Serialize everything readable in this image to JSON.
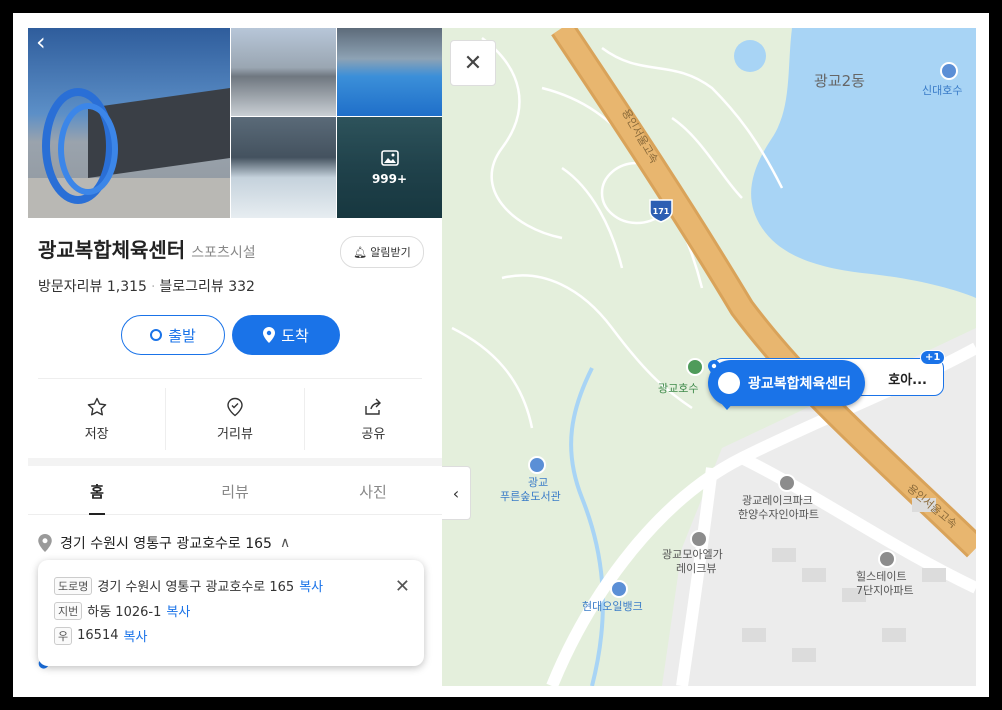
{
  "place": {
    "back_icon": "chevron-left-icon",
    "photo_count": "999+",
    "name": "광교복합체육센터",
    "category": "스포츠시설",
    "alarm_label": "알림받기",
    "visitor_reviews": "방문자리뷰 1,315",
    "blog_reviews": "블로그리뷰 332",
    "depart_label": "출발",
    "arrive_label": "도착"
  },
  "actions": [
    {
      "label": "저장",
      "icon": "star-icon"
    },
    {
      "label": "거리뷰",
      "icon": "streetview-icon"
    },
    {
      "label": "공유",
      "icon": "share-icon"
    }
  ],
  "tabs": [
    {
      "label": "홈",
      "active": true
    },
    {
      "label": "리뷰",
      "active": false
    },
    {
      "label": "사진",
      "active": false
    }
  ],
  "address": {
    "main": "경기 수원시 영통구 광교호수로 165",
    "road_tag": "도로명",
    "road": "경기 수원시 영통구 광교호수로 165",
    "lot_tag": "지번",
    "lot": "하동 1026-1",
    "zip_tag": "우",
    "zip": "16514",
    "copy_label": "복사"
  },
  "map": {
    "labels": {
      "dong": "광교2동",
      "lake": "신대호수",
      "highway": "용인서울고속",
      "highway2": "용인서울고속",
      "route_no": "171",
      "park": "광교호수",
      "library_1": "광교",
      "library_2": "푸른숲도서관",
      "apt1_1": "광교레이크파크",
      "apt1_2": "한양수자인아파트",
      "apt2_1": "광교모아엘가",
      "apt2_2": "레이크뷰",
      "bank": "현대오일뱅크",
      "apt3_1": "힐스테이트",
      "apt3_2": "7단지아파트"
    },
    "pin_label": "광교복합체육센터",
    "more_label": "호아...",
    "plus_badge": "+1",
    "colors": {
      "park": "#e4efdc",
      "water": "#a8d4f5",
      "highway": "#e8b66f",
      "accent": "#1a73e8"
    }
  }
}
